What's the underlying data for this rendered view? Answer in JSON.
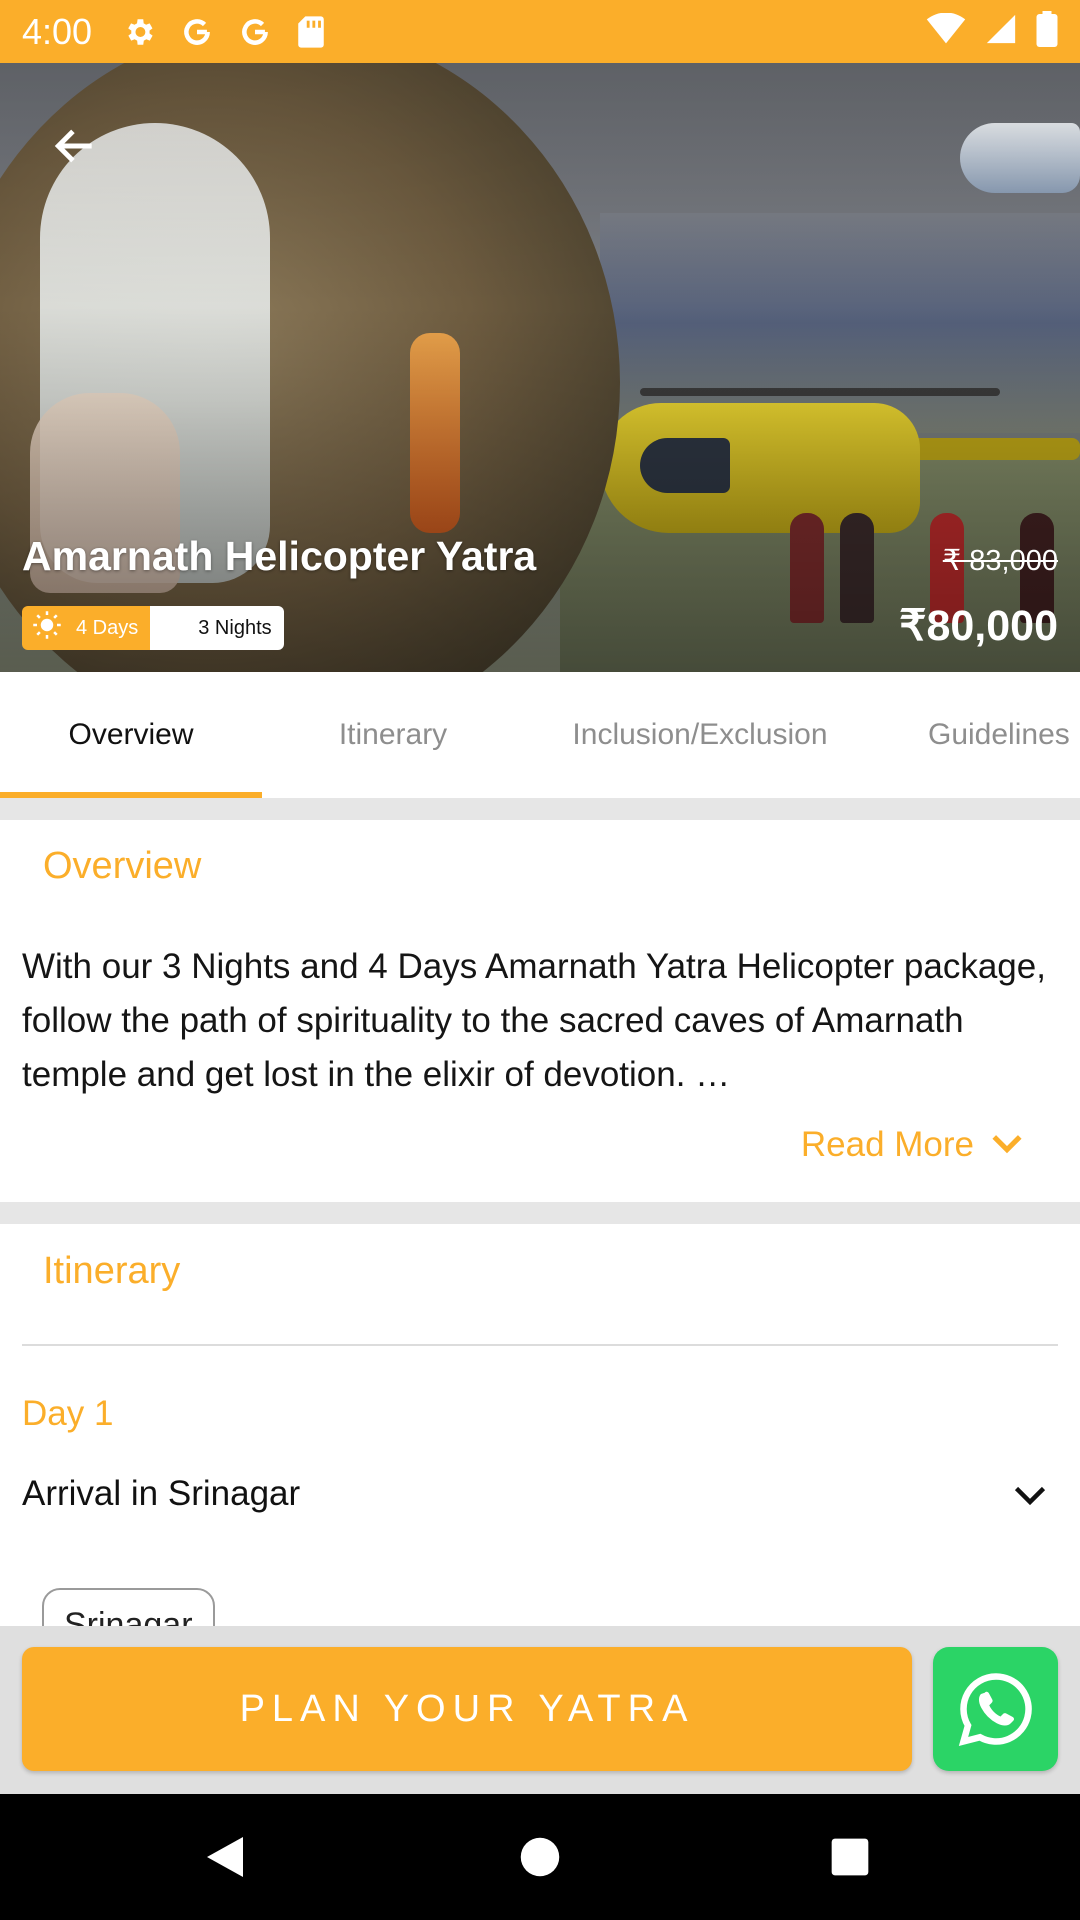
{
  "status_bar": {
    "time": "4:00",
    "icons_left": [
      "gear-icon",
      "google-icon",
      "google-icon",
      "sd-card-icon"
    ],
    "icons_right": [
      "wifi-icon",
      "signal-icon",
      "battery-icon"
    ],
    "background": "#FBAE2A"
  },
  "hero": {
    "title": "Amarnath Helicopter Yatra",
    "days": "4 Days",
    "nights": "3 Nights",
    "old_price": "₹ 83,000",
    "price": "₹80,000"
  },
  "tabs": [
    {
      "label": "Overview",
      "active": true
    },
    {
      "label": "Itinerary",
      "active": false
    },
    {
      "label": "Inclusion/Exclusion",
      "active": false
    },
    {
      "label": "Guidelines",
      "active": false
    }
  ],
  "overview": {
    "heading": "Overview",
    "text": "With our 3 Nights and 4 Days Amarnath Yatra Helicopter package, follow the path of spirituality to the sacred caves of Amarnath temple and get lost in the elixir of devotion. …",
    "read_more": "Read More"
  },
  "itinerary": {
    "heading": "Itinerary",
    "day_label": "Day 1",
    "day_title": "Arrival in Srinagar",
    "place": "Srinagar"
  },
  "cta": {
    "label": "PLAN YOUR YATRA",
    "accent": "#FBAE2A",
    "whatsapp_color": "#2BD466"
  },
  "nav": [
    "back-icon",
    "home-icon",
    "recents-icon"
  ]
}
